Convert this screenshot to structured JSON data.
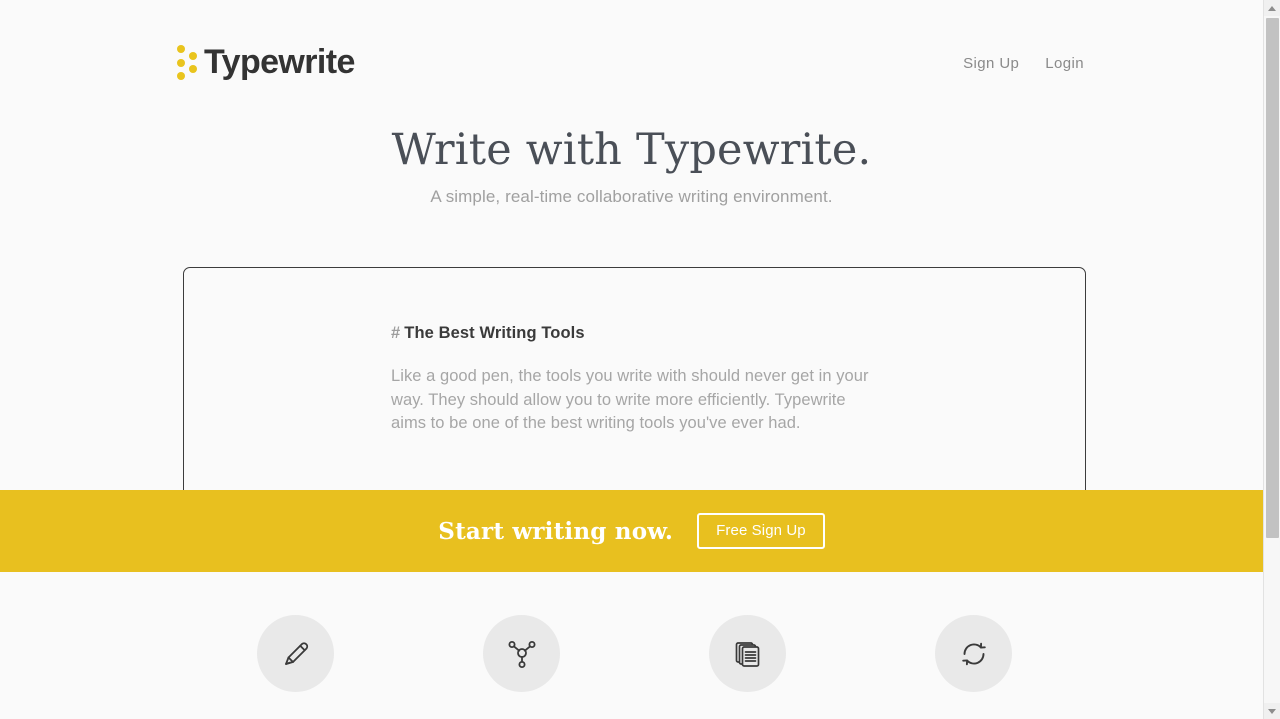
{
  "brand": {
    "name": "Typewrite",
    "logo_icon": "dots-logo-icon",
    "accent_color": "#e8c01f",
    "text_color": "#333333"
  },
  "header": {
    "nav": [
      {
        "label": "Sign Up",
        "name": "nav-sign-up"
      },
      {
        "label": "Login",
        "name": "nav-login"
      }
    ]
  },
  "hero": {
    "title": "Write with Typewrite.",
    "subtitle": "A simple, real-time collaborative writing environment."
  },
  "editor": {
    "heading_marker": "#",
    "heading": "The Best Writing Tools",
    "paragraph": "Like a good pen, the tools you write with should never get in your way. They should allow you to write more efficiently. Typewrite aims to be one of the best writing tools you've ever had."
  },
  "cta": {
    "text": "Start writing now.",
    "button_label": "Free Sign Up",
    "background_color": "#e8c01f",
    "text_color": "#ffffff"
  },
  "features": [
    {
      "icon": "pencil-icon",
      "name": "feature-write"
    },
    {
      "icon": "network-icon",
      "name": "feature-collaborate"
    },
    {
      "icon": "documents-icon",
      "name": "feature-documents"
    },
    {
      "icon": "sync-icon",
      "name": "feature-sync"
    }
  ],
  "scrollbar": {
    "up_icon": "scroll-up-arrow-icon",
    "down_icon": "scroll-down-arrow-icon"
  }
}
